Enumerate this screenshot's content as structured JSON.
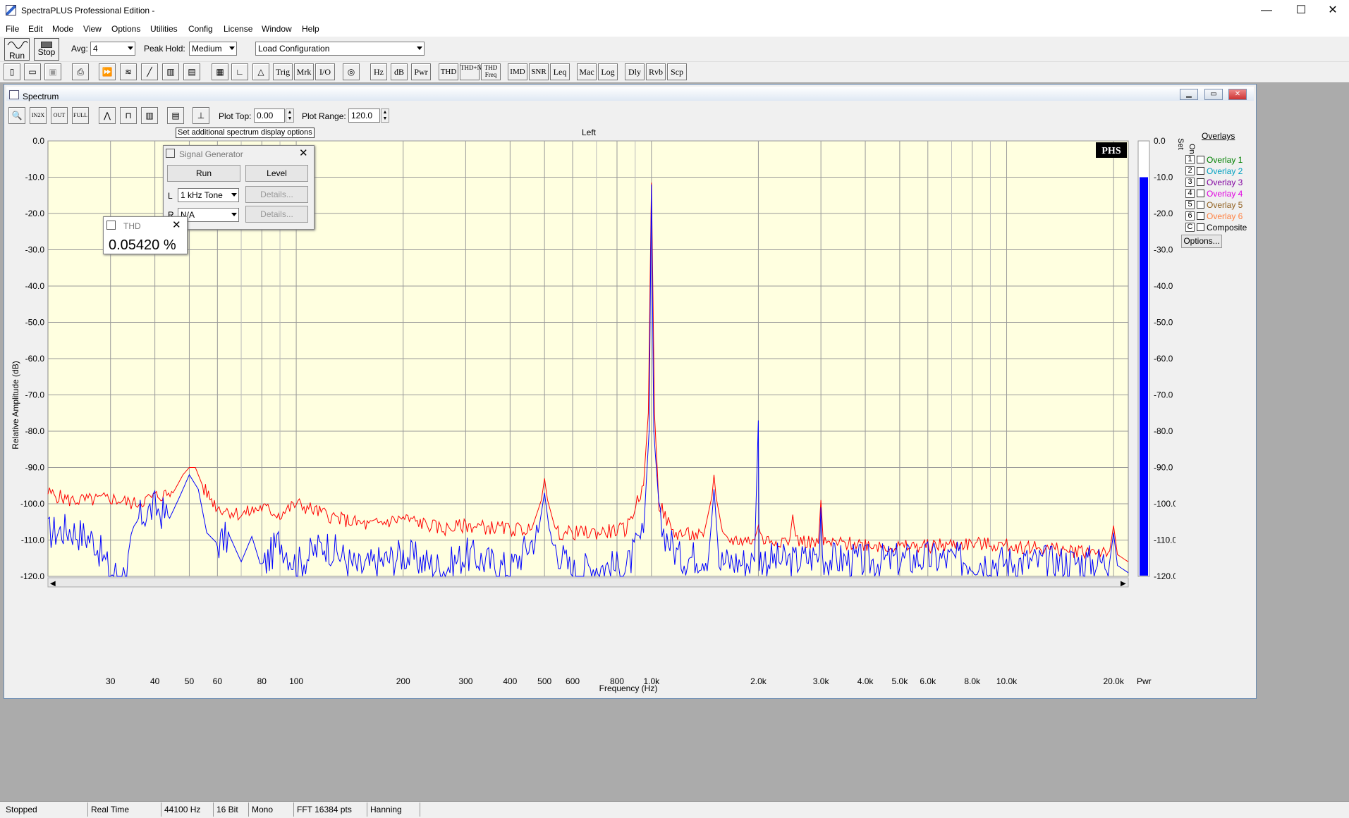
{
  "app": {
    "title": "SpectraPLUS Professional Edition -",
    "win_min": "—",
    "win_max": "☐",
    "win_close": "✕"
  },
  "menu": [
    "File",
    "Edit",
    "Mode",
    "View",
    "Options",
    "Utilities",
    "Config",
    "License",
    "Window",
    "Help"
  ],
  "toolbar1": {
    "run": "Run",
    "stop": "Stop",
    "avg_label": "Avg:",
    "avg_value": "4",
    "peak_label": "Peak Hold:",
    "peak_value": "Medium",
    "config_value": "Load Configuration"
  },
  "toolbar2": {
    "buttons": [
      "Trig",
      "Mrk",
      "I/O",
      "Hz",
      "dB",
      "Pwr",
      "THD",
      "THD+N",
      "THD Freq",
      "IMD",
      "SNR",
      "Leq",
      "Mac",
      "Log",
      "Dly",
      "Rvb",
      "Scp"
    ]
  },
  "spectrum": {
    "title": "Spectrum",
    "plot_top_label": "Plot Top:",
    "plot_top_value": "0.00",
    "plot_range_label": "Plot Range:",
    "plot_range_value": "120.0",
    "tooltip": "Set additional spectrum display options",
    "channel": "Left",
    "logo": "PHS",
    "pwr_label": "Pwr"
  },
  "chart_data": {
    "type": "line",
    "title": "Left",
    "xlabel": "Frequency (Hz)",
    "ylabel": "Relative Amplitude (dB)",
    "x_scale": "log",
    "xlim": [
      20,
      22000
    ],
    "ylim": [
      -120,
      0
    ],
    "y_ticks": [
      "0.0",
      "-10.0",
      "-20.0",
      "-30.0",
      "-40.0",
      "-50.0",
      "-60.0",
      "-70.0",
      "-80.0",
      "-90.0",
      "-100.0",
      "-110.0",
      "-120.0"
    ],
    "x_ticks": [
      {
        "v": 30,
        "t": "30"
      },
      {
        "v": 40,
        "t": "40"
      },
      {
        "v": 50,
        "t": "50"
      },
      {
        "v": 60,
        "t": "60"
      },
      {
        "v": 80,
        "t": "80"
      },
      {
        "v": 100,
        "t": "100"
      },
      {
        "v": 200,
        "t": "200"
      },
      {
        "v": 300,
        "t": "300"
      },
      {
        "v": 400,
        "t": "400"
      },
      {
        "v": 500,
        "t": "500"
      },
      {
        "v": 600,
        "t": "600"
      },
      {
        "v": 800,
        "t": "800"
      },
      {
        "v": 1000,
        "t": "1.0k"
      },
      {
        "v": 2000,
        "t": "2.0k"
      },
      {
        "v": 3000,
        "t": "3.0k"
      },
      {
        "v": 4000,
        "t": "4.0k"
      },
      {
        "v": 5000,
        "t": "5.0k"
      },
      {
        "v": 6000,
        "t": "6.0k"
      },
      {
        "v": 8000,
        "t": "8.0k"
      },
      {
        "v": 10000,
        "t": "10.0k"
      },
      {
        "v": 20000,
        "t": "20.0k"
      }
    ],
    "grid": true,
    "colors": {
      "background": "#ffffe0",
      "peak_hold": "#ff0000",
      "spectrum": "#0000ff",
      "level_bar": "#0000ff"
    },
    "series": [
      {
        "color": "#ff0000",
        "points": [
          [
            20,
            -97
          ],
          [
            23,
            -99
          ],
          [
            27,
            -99
          ],
          [
            30,
            -98.5
          ],
          [
            35,
            -100
          ],
          [
            40,
            -98
          ],
          [
            45,
            -97
          ],
          [
            48,
            -92
          ],
          [
            50,
            -90
          ],
          [
            52,
            -90
          ],
          [
            55,
            -96
          ],
          [
            60,
            -101
          ],
          [
            70,
            -103
          ],
          [
            80,
            -101
          ],
          [
            90,
            -103
          ],
          [
            100,
            -100
          ],
          [
            130,
            -104
          ],
          [
            160,
            -106
          ],
          [
            200,
            -104
          ],
          [
            260,
            -107
          ],
          [
            300,
            -106
          ],
          [
            400,
            -107
          ],
          [
            460,
            -107
          ],
          [
            490,
            -99
          ],
          [
            500,
            -93
          ],
          [
            510,
            -99
          ],
          [
            540,
            -108
          ],
          [
            700,
            -108
          ],
          [
            850,
            -107
          ],
          [
            950,
            -95
          ],
          [
            980,
            -75
          ],
          [
            1000,
            -11.5
          ],
          [
            1020,
            -75
          ],
          [
            1050,
            -100
          ],
          [
            1150,
            -108
          ],
          [
            1400,
            -109
          ],
          [
            1480,
            -98
          ],
          [
            1500,
            -92
          ],
          [
            1520,
            -98
          ],
          [
            1600,
            -110
          ],
          [
            1950,
            -110
          ],
          [
            2000,
            -106
          ],
          [
            2050,
            -110
          ],
          [
            2450,
            -110
          ],
          [
            2500,
            -103
          ],
          [
            2550,
            -110
          ],
          [
            2950,
            -111
          ],
          [
            3000,
            -99
          ],
          [
            3050,
            -111
          ],
          [
            4000,
            -111
          ],
          [
            5000,
            -112
          ],
          [
            8000,
            -111
          ],
          [
            12000,
            -112
          ],
          [
            15000,
            -113
          ],
          [
            19500,
            -113
          ],
          [
            20000,
            -106
          ],
          [
            20500,
            -114
          ],
          [
            22000,
            -116
          ]
        ]
      },
      {
        "color": "#0000ff",
        "points": [
          [
            20,
            -108
          ],
          [
            23,
            -107
          ],
          [
            27,
            -110
          ],
          [
            30,
            -119
          ],
          [
            33,
            -119.5
          ],
          [
            36,
            -104
          ],
          [
            40,
            -101
          ],
          [
            44,
            -104
          ],
          [
            47,
            -98
          ],
          [
            50,
            -92
          ],
          [
            53,
            -96
          ],
          [
            56,
            -108
          ],
          [
            60,
            -111
          ],
          [
            65,
            -109
          ],
          [
            70,
            -116
          ],
          [
            75,
            -109
          ],
          [
            80,
            -118
          ],
          [
            90,
            -110
          ],
          [
            100,
            -117
          ],
          [
            120,
            -111
          ],
          [
            150,
            -118
          ],
          [
            200,
            -114
          ],
          [
            260,
            -118
          ],
          [
            300,
            -114
          ],
          [
            400,
            -118
          ],
          [
            480,
            -108
          ],
          [
            500,
            -97
          ],
          [
            520,
            -110
          ],
          [
            600,
            -119
          ],
          [
            700,
            -117
          ],
          [
            850,
            -118
          ],
          [
            950,
            -108
          ],
          [
            985,
            -80
          ],
          [
            1000,
            -12
          ],
          [
            1015,
            -80
          ],
          [
            1060,
            -106
          ],
          [
            1200,
            -115
          ],
          [
            1450,
            -114
          ],
          [
            1490,
            -100
          ],
          [
            1500,
            -96
          ],
          [
            1510,
            -100
          ],
          [
            1550,
            -116
          ],
          [
            1950,
            -116
          ],
          [
            2000,
            -77
          ],
          [
            2010,
            -115
          ],
          [
            2500,
            -116
          ],
          [
            2970,
            -114
          ],
          [
            3000,
            -101
          ],
          [
            3030,
            -115
          ],
          [
            4000,
            -116
          ],
          [
            6000,
            -115
          ],
          [
            10000,
            -116
          ],
          [
            15000,
            -116
          ],
          [
            19500,
            -116
          ],
          [
            20000,
            -108
          ],
          [
            20500,
            -117
          ],
          [
            22000,
            -119
          ]
        ]
      }
    ],
    "level_bar_db": -10
  },
  "overlays": {
    "title": "Overlays",
    "set_label": "Set",
    "on_label": "On",
    "items": [
      {
        "set": "1",
        "label": "Overlay 1",
        "color": "#008000"
      },
      {
        "set": "2",
        "label": "Overlay 2",
        "color": "#00a0c0"
      },
      {
        "set": "3",
        "label": "Overlay 3",
        "color": "#8000a0"
      },
      {
        "set": "4",
        "label": "Overlay 4",
        "color": "#e000e0"
      },
      {
        "set": "5",
        "label": "Overlay 5",
        "color": "#906020"
      },
      {
        "set": "6",
        "label": "Overlay 6",
        "color": "#ff8040"
      },
      {
        "set": "C",
        "label": "Composite",
        "color": "#000000"
      }
    ],
    "options": "Options..."
  },
  "siggen": {
    "title": "Signal Generator",
    "run": "Run",
    "level": "Level",
    "l_label": "L",
    "l_value": "1 kHz Tone",
    "r_label": "R",
    "r_value": "N/A",
    "details": "Details..."
  },
  "thd": {
    "title": "THD",
    "value": "0.05420 %"
  },
  "status": [
    "Stopped",
    "Real Time",
    "44100 Hz",
    "16 Bit",
    "Mono",
    "FFT 16384 pts",
    "Hanning"
  ]
}
